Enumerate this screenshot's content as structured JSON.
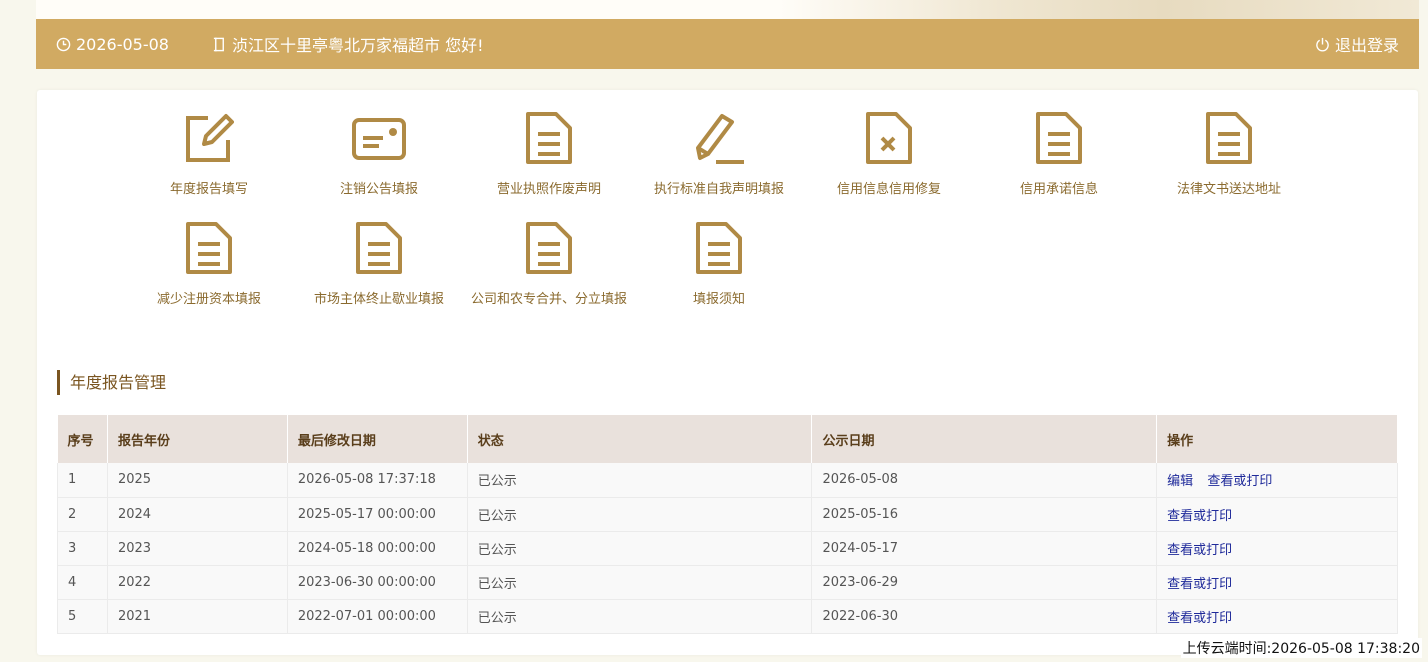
{
  "header": {
    "date": "2026-05-08",
    "greeting": "浈江区十里亭粤北万家福超市 您好!",
    "logout_label": "退出登录"
  },
  "menu": [
    {
      "label": "年度报告填写",
      "icon": "edit-icon"
    },
    {
      "label": "注销公告填报",
      "icon": "card-icon"
    },
    {
      "label": "营业执照作废声明",
      "icon": "document-icon"
    },
    {
      "label": "执行标准自我声明填报",
      "icon": "pencil-icon"
    },
    {
      "label": "信用信息信用修复",
      "icon": "document-x-icon"
    },
    {
      "label": "信用承诺信息",
      "icon": "document-icon"
    },
    {
      "label": "法律文书送达地址",
      "icon": "document-icon"
    },
    {
      "label": "减少注册资本填报",
      "icon": "document-icon"
    },
    {
      "label": "市场主体终止歇业填报",
      "icon": "document-icon"
    },
    {
      "label": "公司和农专合并、分立填报",
      "icon": "document-icon"
    },
    {
      "label": "填报须知",
      "icon": "document-icon"
    }
  ],
  "section_title": "年度报告管理",
  "table": {
    "headers": [
      "序号",
      "报告年份",
      "最后修改日期",
      "状态",
      "公示日期",
      "操作"
    ],
    "rows": [
      {
        "no": "1",
        "year": "2025",
        "modified": "2026-05-08 17:37:18",
        "status": "已公示",
        "publish": "2026-05-08",
        "actions": [
          "编辑",
          "查看或打印"
        ]
      },
      {
        "no": "2",
        "year": "2024",
        "modified": "2025-05-17 00:00:00",
        "status": "已公示",
        "publish": "2025-05-16",
        "actions": [
          "查看或打印"
        ]
      },
      {
        "no": "3",
        "year": "2023",
        "modified": "2024-05-18 00:00:00",
        "status": "已公示",
        "publish": "2024-05-17",
        "actions": [
          "查看或打印"
        ]
      },
      {
        "no": "4",
        "year": "2022",
        "modified": "2023-06-30 00:00:00",
        "status": "已公示",
        "publish": "2023-06-29",
        "actions": [
          "查看或打印"
        ]
      },
      {
        "no": "5",
        "year": "2021",
        "modified": "2022-07-01 00:00:00",
        "status": "已公示",
        "publish": "2022-06-30",
        "actions": [
          "查看或打印"
        ]
      }
    ]
  },
  "upload_time": "上传云端时间:2026-05-08 17:38:20",
  "colors": {
    "header_bg": "#d1aa62",
    "icon": "#b08a45",
    "link": "#1f2a9a"
  }
}
